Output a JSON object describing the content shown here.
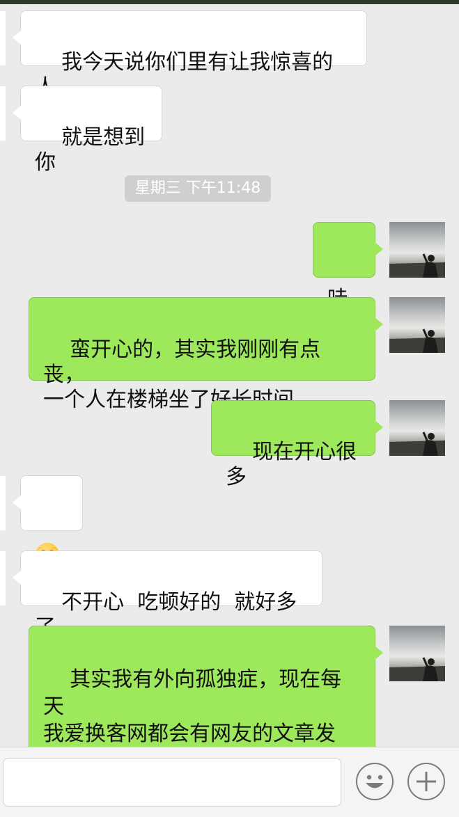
{
  "timestamp": "星期三 下午11:48",
  "messages": [
    {
      "side": "left",
      "text": "我今天说你们里有让我惊喜的人"
    },
    {
      "side": "left",
      "text": "就是想到你"
    },
    {
      "side": "right",
      "text": "哇"
    },
    {
      "side": "right",
      "text": "蛮开心的，其实我刚刚有点丧，\n一个人在楼梯坐了好长时间"
    },
    {
      "side": "right",
      "text": "现在开心很多"
    },
    {
      "side": "left",
      "text": "",
      "emoji": "smiling-face-emoji"
    },
    {
      "side": "left",
      "text": "不开心  吃顿好的  就好多了"
    },
    {
      "side": "right",
      "text": "其实我有外向孤独症，现在每天\n我爱换客网都会有网友的文章发\n帖，我看看他们的文章，也会很\n好"
    }
  ],
  "input": {
    "value": "",
    "placeholder": ""
  },
  "icons": {
    "emoji_button": "smiley-face-icon",
    "more_button": "plus-icon"
  },
  "colors": {
    "sent_bubble": "#9ee85b",
    "received_bubble": "#ffffff",
    "background": "#ebebeb"
  }
}
